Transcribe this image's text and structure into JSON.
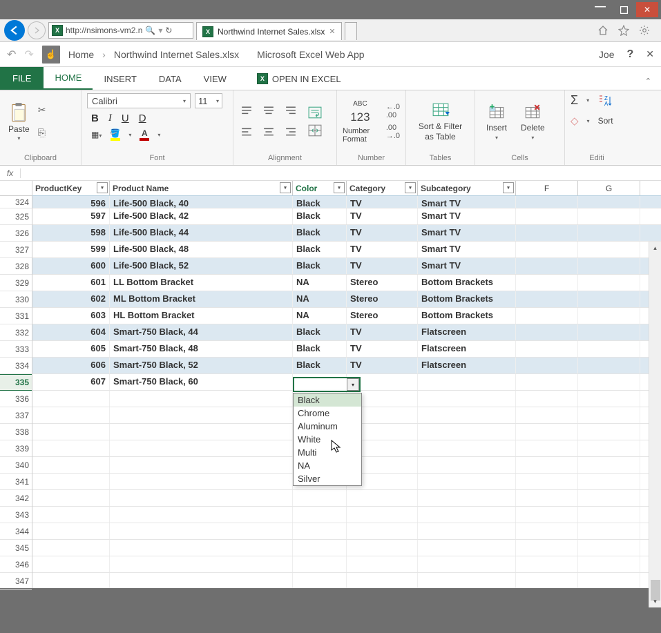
{
  "titlebar": {
    "min": "—",
    "max": "▢",
    "close": "✕"
  },
  "nav": {
    "url": "http://nsimons-vm2.n",
    "search_icon": "🔍",
    "refresh": "↻",
    "tab_title": "Northwind Internet Sales.xlsx",
    "tab_close": "✕"
  },
  "crumb": {
    "undo": "↶",
    "redo": "↷",
    "home": "Home",
    "file": "Northwind Internet Sales.xlsx",
    "app": "Microsoft Excel Web App",
    "user": "Joe",
    "help": "?",
    "close": "✕"
  },
  "ribbon_tabs": {
    "file": "FILE",
    "home": "HOME",
    "insert": "INSERT",
    "data": "DATA",
    "view": "VIEW",
    "open": "OPEN IN EXCEL",
    "collapse": "⌃"
  },
  "ribbon": {
    "clipboard": {
      "paste": "Paste",
      "label": "Clipboard"
    },
    "font": {
      "name": "Calibri",
      "size": "11",
      "bold": "B",
      "italic": "I",
      "underline": "U",
      "double_u": "D",
      "label": "Font"
    },
    "alignment": {
      "label": "Alignment"
    },
    "number": {
      "abc": "ABC",
      "n123": "123",
      "fmt": "Number Format",
      "label": "Number"
    },
    "tables": {
      "sort": "Sort & Filter as Table",
      "label": "Tables"
    },
    "cells": {
      "insert": "Insert",
      "delete": "Delete",
      "label": "Cells"
    },
    "editing": {
      "sigma": "Σ",
      "sort": "Sort",
      "label": "Editi"
    }
  },
  "fx": {
    "label": "fx",
    "value": ""
  },
  "columns": {
    "a": "ProductKey",
    "b": "Product Name",
    "c": "Color",
    "d": "Category",
    "e": "Subcategory",
    "f": "F",
    "g": "G"
  },
  "row_start": 324,
  "rows": [
    {
      "pk": "596",
      "pn": "Life-500 Black, 40",
      "col": "Black",
      "cat": "TV",
      "sub": "Smart TV",
      "banded": true,
      "clip": true
    },
    {
      "pk": "597",
      "pn": "Life-500 Black, 42",
      "col": "Black",
      "cat": "TV",
      "sub": "Smart TV",
      "banded": false
    },
    {
      "pk": "598",
      "pn": "Life-500 Black, 44",
      "col": "Black",
      "cat": "TV",
      "sub": "Smart TV",
      "banded": true
    },
    {
      "pk": "599",
      "pn": "Life-500 Black, 48",
      "col": "Black",
      "cat": "TV",
      "sub": "Smart TV",
      "banded": false
    },
    {
      "pk": "600",
      "pn": "Life-500 Black, 52",
      "col": "Black",
      "cat": "TV",
      "sub": "Smart TV",
      "banded": true
    },
    {
      "pk": "601",
      "pn": "LL Bottom Bracket",
      "col": "NA",
      "cat": "Stereo",
      "sub": "Bottom Brackets",
      "banded": false
    },
    {
      "pk": "602",
      "pn": "ML Bottom Bracket",
      "col": "NA",
      "cat": "Stereo",
      "sub": "Bottom Brackets",
      "banded": true
    },
    {
      "pk": "603",
      "pn": "HL Bottom Bracket",
      "col": "NA",
      "cat": "Stereo",
      "sub": "Bottom Brackets",
      "banded": false
    },
    {
      "pk": "604",
      "pn": "Smart-750 Black, 44",
      "col": "Black",
      "cat": "TV",
      "sub": "Flatscreen",
      "banded": true
    },
    {
      "pk": "605",
      "pn": "Smart-750 Black, 48",
      "col": "Black",
      "cat": "TV",
      "sub": "Flatscreen",
      "banded": false
    },
    {
      "pk": "606",
      "pn": "Smart-750 Black, 52",
      "col": "Black",
      "cat": "TV",
      "sub": "Flatscreen",
      "banded": true
    },
    {
      "pk": "607",
      "pn": "Smart-750 Black, 60",
      "col": "",
      "cat": "",
      "sub": "",
      "banded": false,
      "editing": true
    }
  ],
  "dropdown_options": [
    "Black",
    "Chrome",
    "Aluminum",
    "White",
    "Multi",
    "NA",
    "Silver"
  ],
  "dropdown_selected": 0,
  "empty_rows_after": 12,
  "colors": {
    "accent": "#217346",
    "band": "#dce8f1"
  }
}
